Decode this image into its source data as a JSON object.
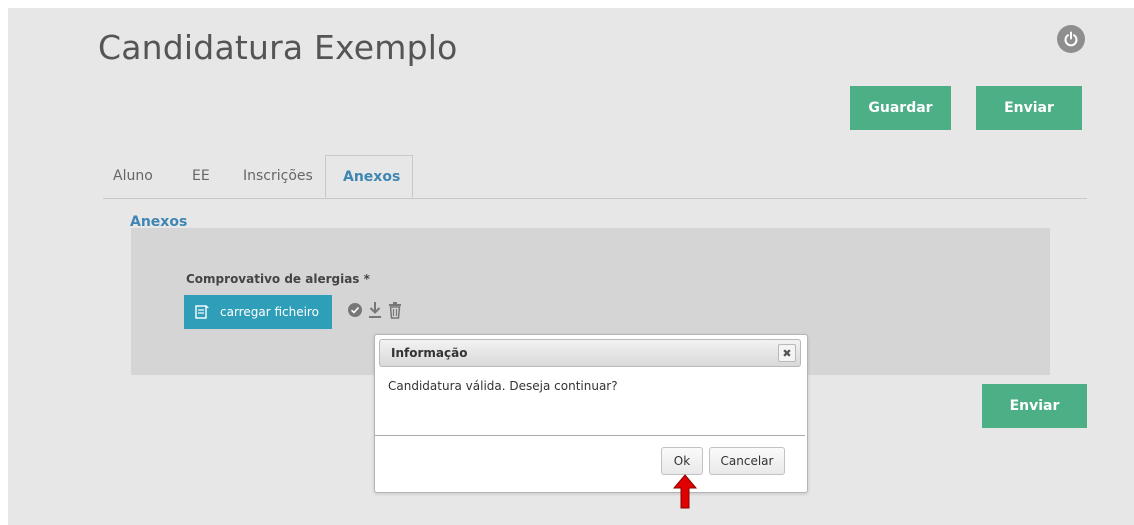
{
  "app": {
    "title": "Candidatura Exemplo",
    "power_icon": "power-icon"
  },
  "header": {
    "save_label": "Guardar",
    "send_label": "Enviar"
  },
  "tabs": [
    {
      "label": "Aluno",
      "active": false
    },
    {
      "label": "EE",
      "active": false
    },
    {
      "label": "Inscrições",
      "active": false
    },
    {
      "label": "Anexos",
      "active": true
    }
  ],
  "annexes": {
    "section_title": "Anexos",
    "field_label": "Comprovativo de alergias *",
    "upload_label": "carregar ficheiro",
    "icons": [
      "upload-file-icon",
      "check-circle-icon",
      "download-icon",
      "trash-icon"
    ]
  },
  "footer": {
    "send_label": "Enviar"
  },
  "dialog": {
    "title": "Informação",
    "message": "Candidatura válida. Deseja continuar?",
    "ok_label": "Ok",
    "cancel_label": "Cancelar",
    "close_icon": "close-icon"
  },
  "colors": {
    "accent_green": "#4caf86",
    "accent_blue": "#3f86b3",
    "upload_blue": "#2f9fb9",
    "arrow_red": "#e00000"
  }
}
